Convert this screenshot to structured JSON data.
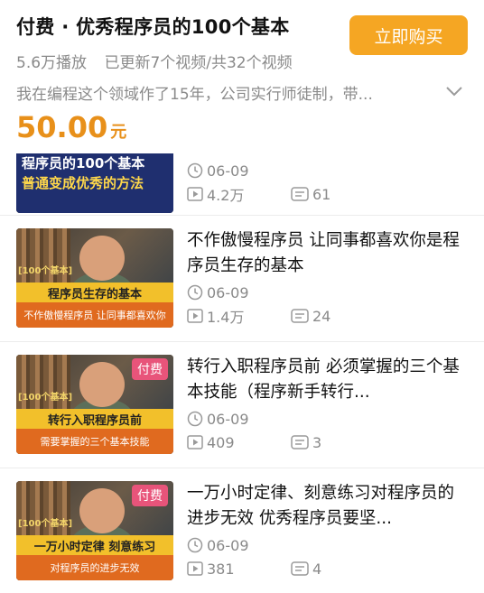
{
  "header": {
    "title": "付费 · 优秀程序员的100个基本",
    "buy_label": "立即购买",
    "plays": "5.6万播放",
    "update_info": "已更新7个视频/共32个视频",
    "description": "我在编程这个领域作了15年，公司实行师徒制，带...",
    "price": "50.00",
    "price_unit": "元"
  },
  "videos": [
    {
      "thumb_line1": "程序员的100个基本",
      "thumb_line2": "普通变成优秀的方法",
      "date": "06-09",
      "plays": "4.2万",
      "danmaku": "61"
    },
    {
      "title": "不作傲慢程序员 让同事都喜欢你是程序员生存的基本",
      "thumb_tag": "[100个基本]",
      "thumb_band1": "程序员生存的基本",
      "thumb_band2": "不作傲慢程序员 让同事都喜欢你",
      "date": "06-09",
      "plays": "1.4万",
      "danmaku": "24"
    },
    {
      "title": "转行入职程序员前 必须掌握的三个基本技能（程序新手转行...",
      "paid": "付费",
      "thumb_tag": "[100个基本]",
      "thumb_band1": "转行入职程序员前",
      "thumb_band2": "需要掌握的三个基本技能",
      "date": "06-09",
      "plays": "409",
      "danmaku": "3"
    },
    {
      "title": "一万小时定律、刻意练习对程序员的进步无效 优秀程序员要坚...",
      "paid": "付费",
      "thumb_tag": "[100个基本]",
      "thumb_band1": "一万小时定律 刻意练习",
      "thumb_band2": "对程序员的进步无效",
      "date": "06-09",
      "plays": "381",
      "danmaku": "4"
    }
  ],
  "icons": {
    "clock": "clock-icon",
    "play": "play-icon",
    "danmaku": "danmaku-icon",
    "chevron": "chevron-down-icon"
  },
  "colors": {
    "accent": "#f5a623",
    "price": "#e8901a",
    "paid_badge": "#e8547a"
  }
}
